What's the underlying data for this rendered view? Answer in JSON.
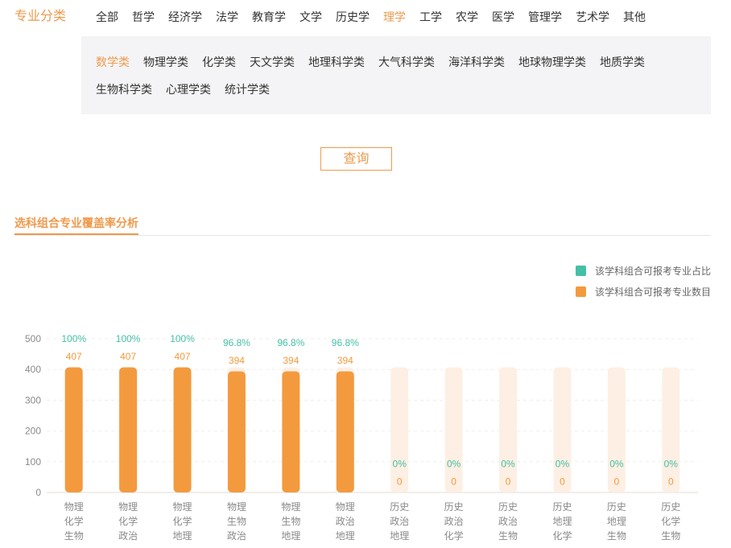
{
  "header": {
    "label": "专业分类"
  },
  "categories": [
    {
      "label": "全部",
      "active": false
    },
    {
      "label": "哲学",
      "active": false
    },
    {
      "label": "经济学",
      "active": false
    },
    {
      "label": "法学",
      "active": false
    },
    {
      "label": "教育学",
      "active": false
    },
    {
      "label": "文学",
      "active": false
    },
    {
      "label": "历史学",
      "active": false
    },
    {
      "label": "理学",
      "active": true
    },
    {
      "label": "工学",
      "active": false
    },
    {
      "label": "农学",
      "active": false
    },
    {
      "label": "医学",
      "active": false
    },
    {
      "label": "管理学",
      "active": false
    },
    {
      "label": "艺术学",
      "active": false
    },
    {
      "label": "其他",
      "active": false
    }
  ],
  "subcategories": [
    {
      "label": "数学类",
      "active": true
    },
    {
      "label": "物理学类",
      "active": false
    },
    {
      "label": "化学类",
      "active": false
    },
    {
      "label": "天文学类",
      "active": false
    },
    {
      "label": "地理科学类",
      "active": false
    },
    {
      "label": "大气科学类",
      "active": false
    },
    {
      "label": "海洋科学类",
      "active": false
    },
    {
      "label": "地球物理学类",
      "active": false
    },
    {
      "label": "地质学类",
      "active": false
    },
    {
      "label": "生物科学类",
      "active": false
    },
    {
      "label": "心理学类",
      "active": false
    },
    {
      "label": "统计学类",
      "active": false
    }
  ],
  "query_button": {
    "label": "查询"
  },
  "section": {
    "title": "选科组合专业覆盖率分析"
  },
  "colors": {
    "accent": "#ee9a4d",
    "panel_background": "#f4f4f6",
    "bar_background": "#fdefe3",
    "axis_text": "#8a8a8a",
    "grid": "#eeeeee",
    "baseline": "#e3ddd6"
  },
  "chart_data": {
    "type": "bar",
    "categories": [
      [
        "物理",
        "化学",
        "生物"
      ],
      [
        "物理",
        "化学",
        "政治"
      ],
      [
        "物理",
        "化学",
        "地理"
      ],
      [
        "物理",
        "生物",
        "政治"
      ],
      [
        "物理",
        "生物",
        "地理"
      ],
      [
        "物理",
        "政治",
        "地理"
      ],
      [
        "历史",
        "政治",
        "地理"
      ],
      [
        "历史",
        "政治",
        "化学"
      ],
      [
        "历史",
        "政治",
        "生物"
      ],
      [
        "历史",
        "地理",
        "化学"
      ],
      [
        "历史",
        "地理",
        "生物"
      ],
      [
        "历史",
        "化学",
        "生物"
      ]
    ],
    "series": [
      {
        "name": "该学科组合可报考专业占比",
        "values": [
          100,
          100,
          100,
          96.8,
          96.8,
          96.8,
          0,
          0,
          0,
          0,
          0,
          0
        ],
        "label_suffix": "%",
        "color": "#45bfa5"
      },
      {
        "name": "该学科组合可报考专业数目",
        "values": [
          407,
          407,
          407,
          394,
          394,
          394,
          0,
          0,
          0,
          0,
          0,
          0
        ],
        "color": "#f39a3e"
      }
    ],
    "max_value": 407,
    "ylim": [
      0,
      500
    ],
    "yticks": [
      0,
      100,
      200,
      300,
      400,
      500
    ],
    "grid": true,
    "legend": "top-right"
  }
}
